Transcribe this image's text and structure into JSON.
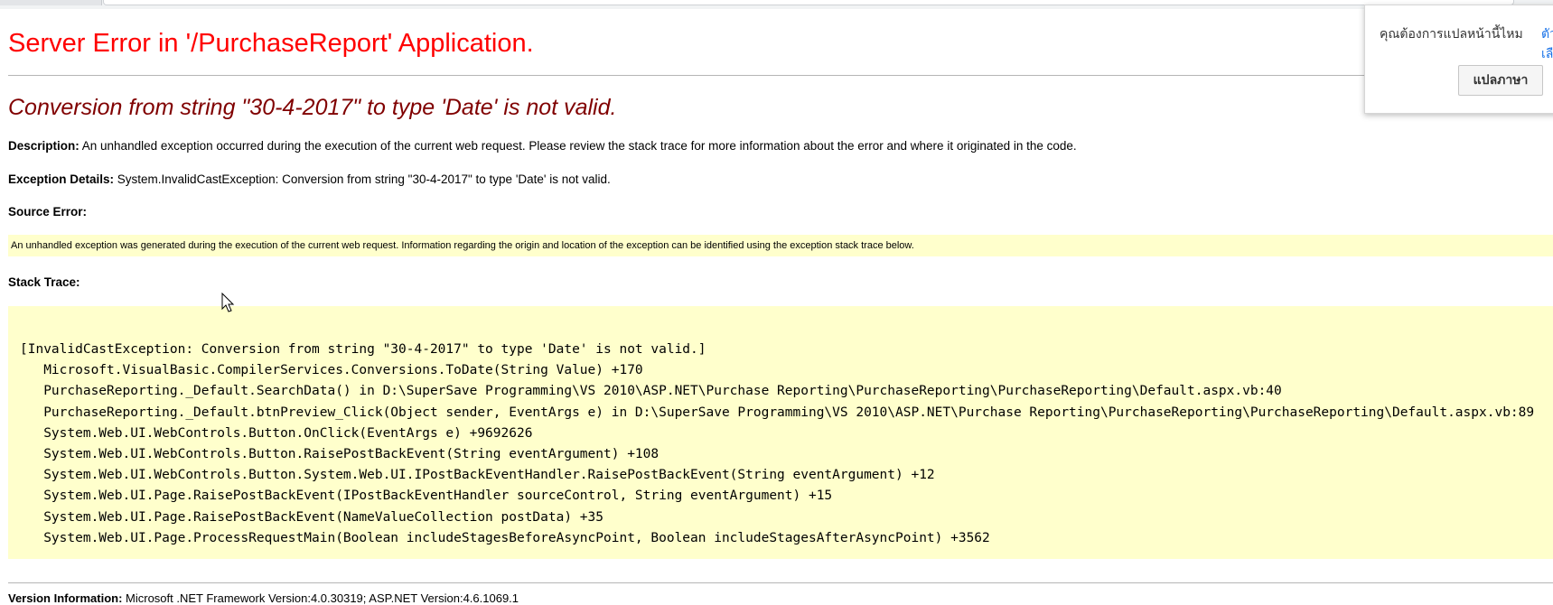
{
  "page": {
    "title": "Server Error in '/PurchaseReport' Application.",
    "subtitle": "Conversion from string \"30-4-2017\" to type 'Date' is not valid.",
    "description_label": "Description:",
    "description_text": " An unhandled exception occurred during the execution of the current web request. Please review the stack trace for more information about the error and where it originated in the code.",
    "exception_label": "Exception Details:",
    "exception_text": " System.InvalidCastException: Conversion from string \"30-4-2017\" to type 'Date' is not valid.",
    "source_error_label": "Source Error:",
    "source_error_text": "An unhandled exception was generated during the execution of the current web request. Information regarding the origin and location of the exception can be identified using the exception stack trace below.",
    "stack_trace_label": "Stack Trace:",
    "stack_trace_lines": [
      "[InvalidCastException: Conversion from string \"30-4-2017\" to type 'Date' is not valid.]",
      "   Microsoft.VisualBasic.CompilerServices.Conversions.ToDate(String Value) +170",
      "   PurchaseReporting._Default.SearchData() in D:\\SuperSave Programming\\VS 2010\\ASP.NET\\Purchase Reporting\\PurchaseReporting\\PurchaseReporting\\Default.aspx.vb:40",
      "   PurchaseReporting._Default.btnPreview_Click(Object sender, EventArgs e) in D:\\SuperSave Programming\\VS 2010\\ASP.NET\\Purchase Reporting\\PurchaseReporting\\PurchaseReporting\\Default.aspx.vb:89",
      "   System.Web.UI.WebControls.Button.OnClick(EventArgs e) +9692626",
      "   System.Web.UI.WebControls.Button.RaisePostBackEvent(String eventArgument) +108",
      "   System.Web.UI.WebControls.Button.System.Web.UI.IPostBackEventHandler.RaisePostBackEvent(String eventArgument) +12",
      "   System.Web.UI.Page.RaisePostBackEvent(IPostBackEventHandler sourceControl, String eventArgument) +15",
      "   System.Web.UI.Page.RaisePostBackEvent(NameValueCollection postData) +35",
      "   System.Web.UI.Page.ProcessRequestMain(Boolean includeStagesBeforeAsyncPoint, Boolean includeStagesAfterAsyncPoint) +3562"
    ],
    "version_label": "Version Information:",
    "version_text": " Microsoft .NET Framework Version:4.0.30319; ASP.NET Version:4.6.1069.1"
  },
  "translate_popup": {
    "question": "คุณต้องการแปลหน้านี้ไหม",
    "option_link": "ตัวเลือก",
    "translate_button": "แปลภาษา"
  },
  "icons": {
    "cursor": "mouse-pointer-icon"
  },
  "colors": {
    "title": "#ff0000",
    "subtitle": "#800000",
    "code_background": "#ffffcc"
  }
}
